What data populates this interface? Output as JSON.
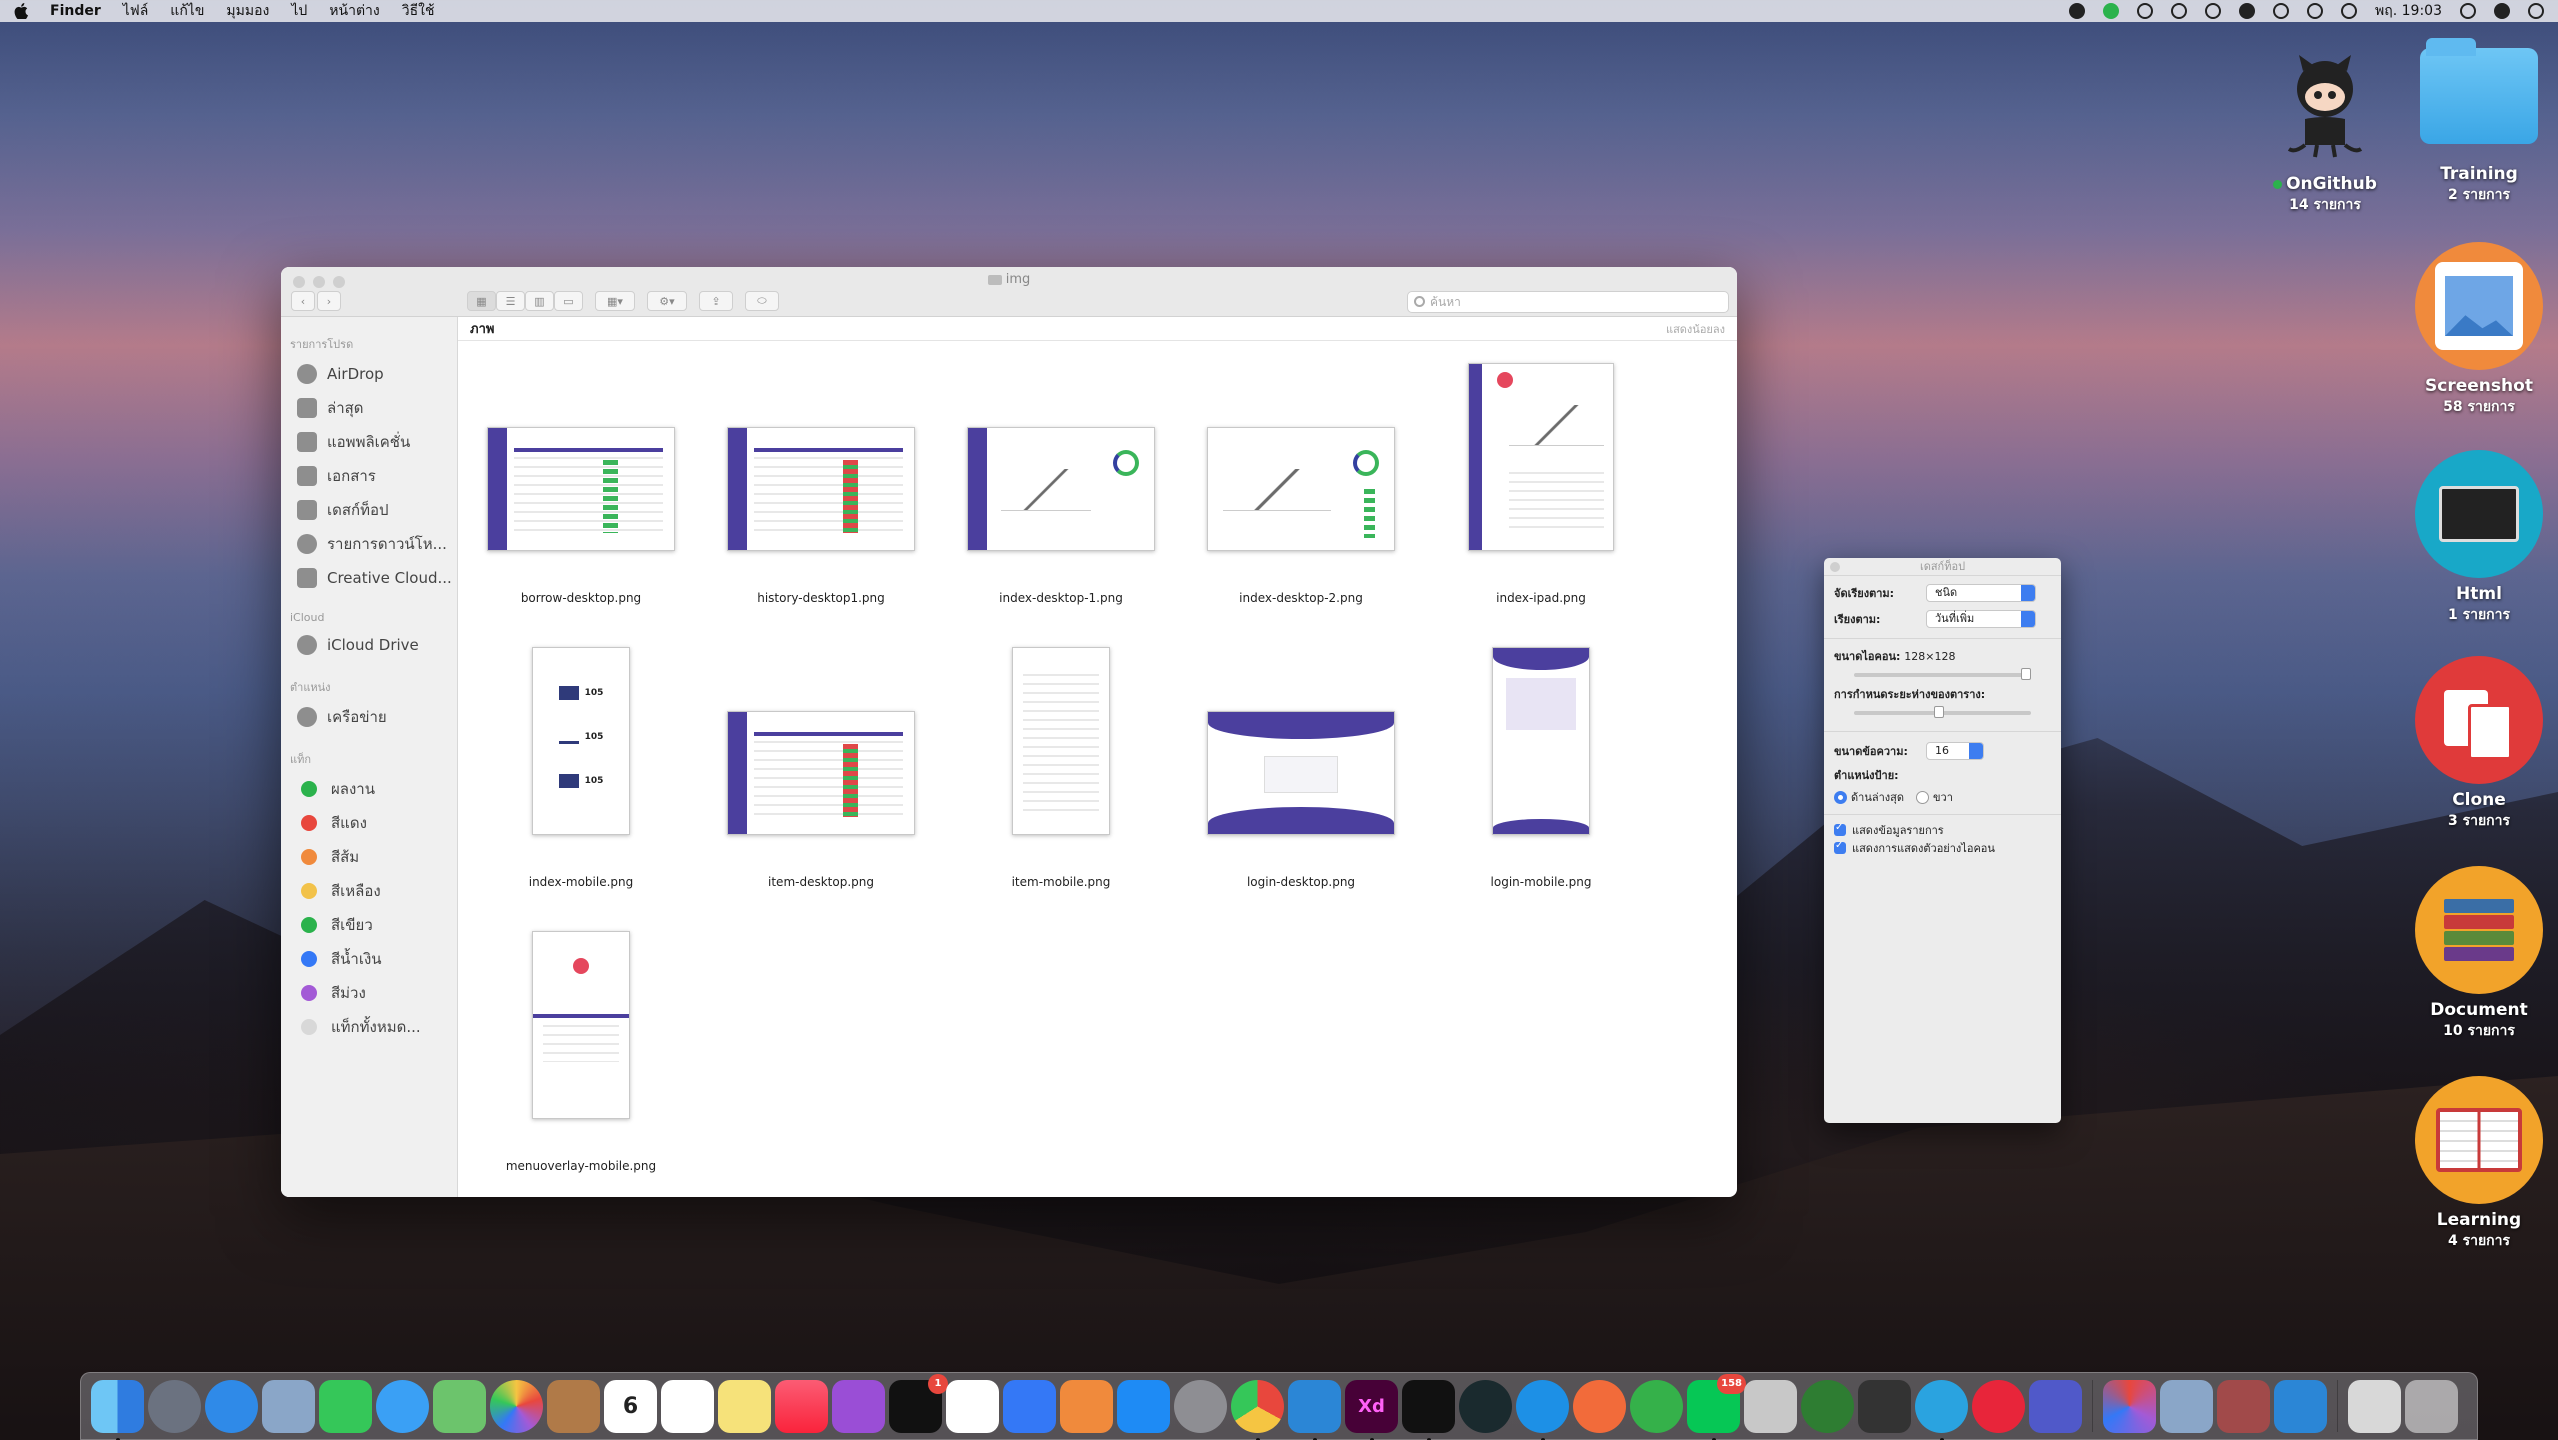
{
  "menubar": {
    "app": "Finder",
    "items": [
      "ไฟล์",
      "แก้ไข",
      "มุมมอง",
      "ไป",
      "หน้าต่าง",
      "วิธีใช้"
    ],
    "clock": "พฤ. 19:03"
  },
  "desktop": [
    {
      "name": "OnGithub",
      "count": "14 รายการ",
      "icon": "github-octocat-icon"
    },
    {
      "name": "Training",
      "count": "2 รายการ",
      "icon": "folder-icon"
    },
    {
      "name": "Screenshot",
      "count": "58 รายการ",
      "icon": "image-icon"
    },
    {
      "name": "Html",
      "count": "1 รายการ",
      "icon": "code-monitor-icon"
    },
    {
      "name": "Clone",
      "count": "3 รายการ",
      "icon": "copy-icon"
    },
    {
      "name": "Document",
      "count": "10 รายการ",
      "icon": "books-icon"
    },
    {
      "name": "Learning",
      "count": "4 รายการ",
      "icon": "open-book-icon"
    }
  ],
  "finder": {
    "title": "img",
    "search_placeholder": "ค้นหา",
    "location": "ภาพ",
    "show_options": "แสดงน้อยลง",
    "sidebar": {
      "favorites_header": "รายการโปรด",
      "favorites": [
        "AirDrop",
        "ล่าสุด",
        "แอพพลิเคชั่น",
        "เอกสาร",
        "เดสก์ท็อป",
        "รายการดาวน์โห...",
        "Creative Cloud..."
      ],
      "icloud_header": "iCloud",
      "icloud": [
        "iCloud Drive"
      ],
      "locations_header": "ตำแหน่ง",
      "locations": [
        "เครือข่าย"
      ],
      "tags_header": "แท็ก",
      "tags": [
        {
          "label": "ผลงาน",
          "color": "#2bb24c"
        },
        {
          "label": "สีแดง",
          "color": "#e8473d"
        },
        {
          "label": "สีส้ม",
          "color": "#f08a3c"
        },
        {
          "label": "สีเหลือง",
          "color": "#f2c24a"
        },
        {
          "label": "สีเขียว",
          "color": "#2bb24c"
        },
        {
          "label": "สีน้ำเงิน",
          "color": "#3478f6"
        },
        {
          "label": "สีม่วง",
          "color": "#a35ad6"
        },
        {
          "label": "แท็กทั้งหมด...",
          "color": "#d8d8d8"
        }
      ]
    },
    "files": [
      "borrow-desktop.png",
      "history-desktop1.png",
      "index-desktop-1.png",
      "index-desktop-2.png",
      "index-ipad.png",
      "index-mobile.png",
      "item-desktop.png",
      "item-mobile.png",
      "login-desktop.png",
      "login-mobile.png",
      "menuoverlay-mobile.png"
    ],
    "mobile_stats": [
      "105",
      "105",
      "105"
    ]
  },
  "view_options": {
    "title": "เดสก์ท็อป",
    "sort_by_label": "จัดเรียงตาม:",
    "sort_by_value": "ชนิด",
    "arrange_label": "เรียงตาม:",
    "arrange_value": "วันที่เพิ่ม",
    "icon_size_label": "ขนาดไอคอน:",
    "icon_size_value": "128×128",
    "grid_spacing_label": "การกำหนดระยะห่างของตาราง:",
    "text_size_label": "ขนาดข้อความ:",
    "text_size_value": "16",
    "label_position_label": "ตำแหน่งป้าย:",
    "label_bottom": "ด้านล่างสุด",
    "label_right": "ขวา",
    "show_item_info": "แสดงข้อมูลรายการ",
    "show_icon_preview": "แสดงการแสดงตัวอย่างไอคอน"
  },
  "dock": {
    "line_badge": "158",
    "tv_badge": "1",
    "calendar_day": "6",
    "xd_label": "Xd"
  }
}
